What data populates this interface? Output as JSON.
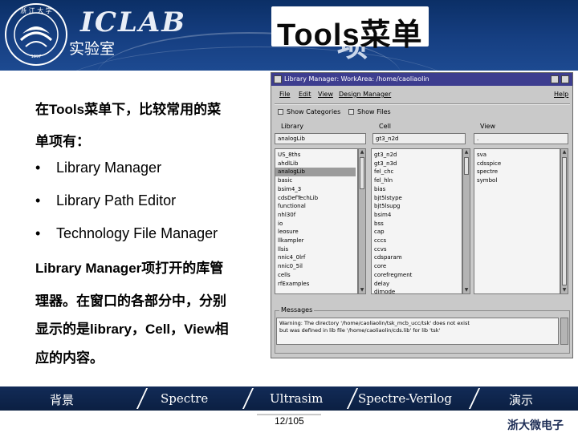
{
  "header": {
    "brand": "ICLAB",
    "brand_sub": "实验室",
    "title": "Tools菜单",
    "title_overflow": "项"
  },
  "body_text": {
    "intro_line1": "在Tools菜单下，比较常用的菜",
    "intro_line2": "单项有：",
    "bullets": [
      "Library Manager",
      "Library Path Editor",
      "Technology File Manager"
    ],
    "desc_line1": "Library Manager项打开的库管",
    "desc_line2": "理器。在窗口的各部分中，分别",
    "desc_line3": "显示的是library，Cell，View相",
    "desc_line4": "应的内容。"
  },
  "window": {
    "title": "Library Manager: WorkArea: /home/caoliaolin",
    "menus": [
      "File",
      "Edit",
      "View",
      "Design Manager",
      "Help"
    ],
    "show_categories": "Show Categories",
    "show_files": "Show Files",
    "library_label": "Library",
    "cell_label": "Cell",
    "view_label": "View",
    "library_field": "analogLib",
    "cell_field": "gt3_n2d",
    "view_field": ".",
    "libraries": [
      "US_8ths",
      "ahdlLib",
      "analogLib",
      "basic",
      "bsim4_3",
      "cdsDefTechLib",
      "functional",
      "nhl30f",
      "io",
      "leosure",
      "llkampler",
      "llsis",
      "nnic4_0lrf",
      "nnic0_5il",
      "cells",
      "rfExamples"
    ],
    "libraries_selected": 2,
    "cells": [
      "gt3_n2d",
      "gt3_n3d",
      "fel_chc",
      "fel_hln",
      "bias",
      "bjt5lstype",
      "bjt5lsupg",
      "bsim4",
      "bss",
      "cap",
      "cccs",
      "ccvs",
      "cdsparam",
      "core",
      "corefregment",
      "delay",
      "dimode",
      "diode"
    ],
    "views": [
      "sva",
      "cdsspice",
      "spectre",
      "symbol"
    ],
    "messages_label": "Messages",
    "messages": [
      "Warning: The directory '/home/caoliaolin/tsk_mcb_ucc/tsk' does not exist",
      "  but was defined in lib file '/home/caoliaolin/cds.lib' for lib 'tsk'"
    ]
  },
  "footer": {
    "nav": [
      "背景",
      "Spectre",
      "Ultrasim",
      "Spectre-Verilog",
      "演示"
    ],
    "page": "12/105",
    "university": "浙大微电子"
  }
}
